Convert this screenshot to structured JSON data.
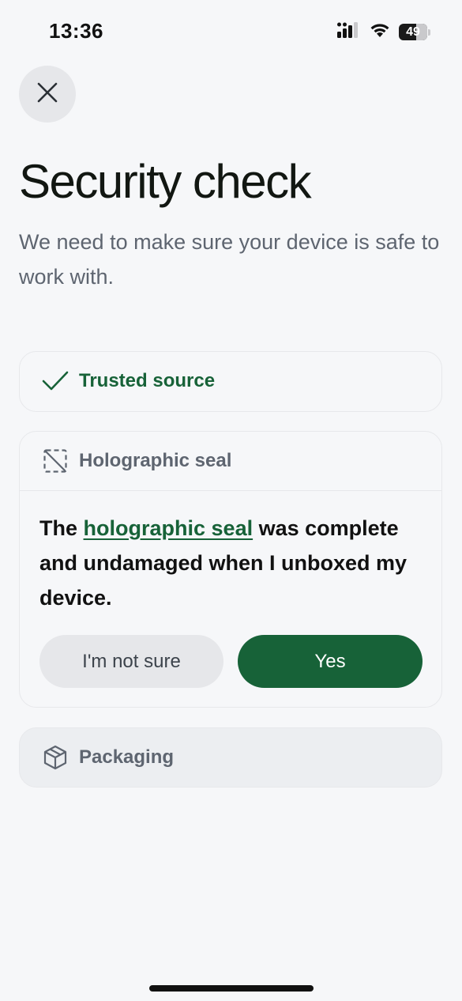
{
  "status_bar": {
    "time": "13:36",
    "battery_percent": "49",
    "icons": [
      "signal-icon",
      "wifi-icon",
      "battery-icon"
    ]
  },
  "header": {
    "close_icon": "close-icon",
    "title": "Security check",
    "subtitle": "We need to make sure your device is safe to work with."
  },
  "checks": {
    "trusted": {
      "label": "Trusted source",
      "icon": "checkmark-icon",
      "status": "done"
    },
    "seal": {
      "label": "Holographic seal",
      "icon": "dashed-square-icon",
      "question_prefix": "The",
      "question_link": "holographic seal",
      "question_suffix": "was complete and undamaged when I unboxed my device.",
      "secondary_button": "I'm not sure",
      "primary_button": "Yes"
    },
    "packaging": {
      "label": "Packaging",
      "icon": "box-icon"
    }
  },
  "colors": {
    "accent": "#176238",
    "background": "#f6f7f9",
    "muted_text": "#5e6570"
  }
}
